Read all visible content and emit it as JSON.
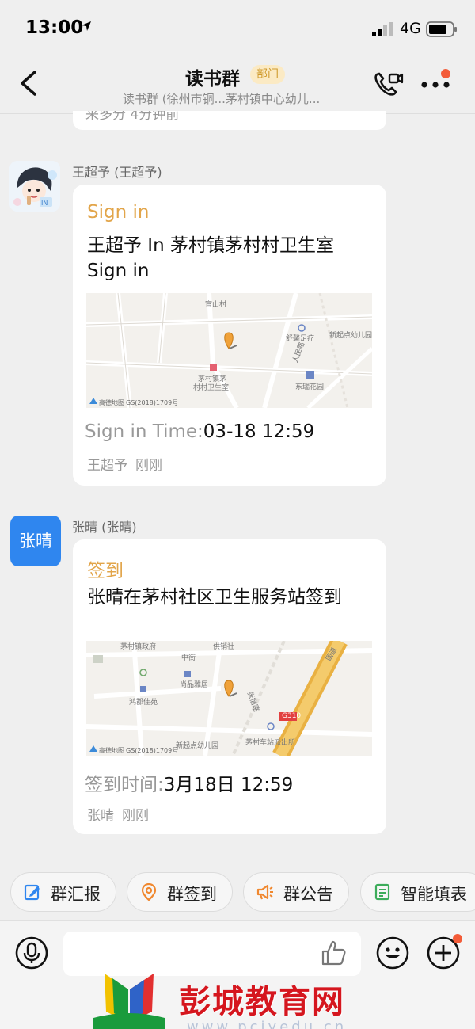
{
  "status_bar": {
    "time": "13:00",
    "network": "4G"
  },
  "header": {
    "title": "读书群",
    "badge": "部门",
    "subtitle": "读书群 (徐州市铜...茅村镇中心幼儿..."
  },
  "previous_message": {
    "partial_text": "来多分 4分钟前"
  },
  "messages": [
    {
      "sender": "王超予 (王超予)",
      "type_label": "Sign in",
      "content": "王超予 In 茅村镇茅村村卫生室 Sign in",
      "map": {
        "labels": [
          "官山村",
          "舒馨足疗",
          "新起点幼儿园",
          "人民路",
          "茅村镇茅",
          "村村卫生室",
          "东瑞花园",
          "高德地图",
          "GS(2018)1709号"
        ]
      },
      "time_label": "Sign in Time:",
      "time_value": "03-18 12:59",
      "footer_name": "王超予",
      "footer_time": "刚刚"
    },
    {
      "sender": "张晴 (张晴)",
      "avatar_text": "张晴",
      "type_label": "签到",
      "content": "张晴在茅村社区卫生服务站签到",
      "map": {
        "labels": [
          "茅村镇政府",
          "供销社",
          "中街",
          "尚品雅居",
          "鸿郡佳苑",
          "张宿路",
          "G310",
          "新起点幼儿园",
          "茅村车站派出所",
          "高德地图",
          "GS(2018)1709号",
          "国道"
        ]
      },
      "time_label": "签到时间:",
      "time_value": "3月18日 12:59",
      "footer_name": "张晴",
      "footer_time": "刚刚"
    }
  ],
  "quick_actions": [
    {
      "label": "群汇报",
      "icon": "report-icon",
      "color": "#2f86ef"
    },
    {
      "label": "群签到",
      "icon": "location-pin-icon",
      "color": "#f0882f"
    },
    {
      "label": "群公告",
      "icon": "megaphone-icon",
      "color": "#f0882f"
    },
    {
      "label": "智能填表",
      "icon": "form-icon",
      "color": "#3cac5a"
    }
  ],
  "input": {
    "placeholder": ""
  },
  "watermark": {
    "text": "彭城教育网",
    "url": "www.pcjyedu.cn"
  },
  "colors": {
    "accent_orange": "#e2a54a",
    "avatar_blue": "#2f86ef",
    "notify_red": "#f35b38",
    "watermark_red": "#d5161e"
  }
}
